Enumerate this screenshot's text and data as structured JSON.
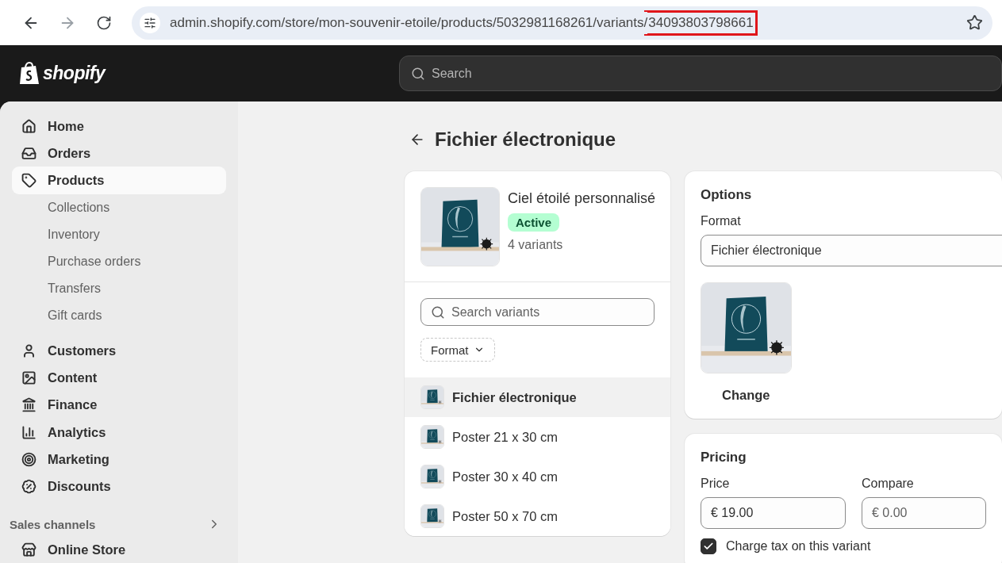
{
  "browser": {
    "url": "admin.shopify.com/store/mon-souvenir-etoile/products/5032981168261/variants/",
    "url_highlight": "34093803798661"
  },
  "topbar": {
    "logo": "shopify",
    "search_placeholder": "Search"
  },
  "sidebar": {
    "items": [
      {
        "label": "Home",
        "selected": false
      },
      {
        "label": "Orders",
        "selected": false
      },
      {
        "label": "Products",
        "selected": true,
        "children": [
          {
            "label": "Collections",
            "selected": false
          },
          {
            "label": "Inventory",
            "selected": false
          },
          {
            "label": "Purchase orders",
            "selected": false
          },
          {
            "label": "Transfers",
            "selected": false
          },
          {
            "label": "Gift cards",
            "selected": false
          }
        ]
      },
      {
        "label": "Customers",
        "selected": false
      },
      {
        "label": "Content",
        "selected": false
      },
      {
        "label": "Finance",
        "selected": false
      },
      {
        "label": "Analytics",
        "selected": false
      },
      {
        "label": "Marketing",
        "selected": false
      },
      {
        "label": "Discounts",
        "selected": false
      }
    ],
    "sections": [
      {
        "title": "Sales channels",
        "items": [
          {
            "label": "Online Store",
            "selected": false
          }
        ]
      }
    ]
  },
  "page": {
    "title": "Fichier électronique"
  },
  "product": {
    "name": "Ciel étoilé personnalisé",
    "status": "Active",
    "variant_count": "4 variants"
  },
  "variant_search": {
    "placeholder": "Search variants"
  },
  "filter": {
    "label": "Format"
  },
  "variants": [
    {
      "label": "Fichier électronique",
      "selected": true
    },
    {
      "label": "Poster 21 x 30 cm",
      "selected": false
    },
    {
      "label": "Poster 30 x 40 cm",
      "selected": false
    },
    {
      "label": "Poster 50 x 70 cm",
      "selected": false
    }
  ],
  "options": {
    "title": "Options",
    "option_label": "Format",
    "value": "Fichier électronique",
    "change": "Change"
  },
  "pricing": {
    "title": "Pricing",
    "price_label": "Price",
    "price_currency": "€",
    "price": "19.00",
    "compare_label": "Compare",
    "compare_currency": "€",
    "compare_placeholder": "0.00",
    "tax": {
      "label": "Charge tax on this variant",
      "checked": true
    }
  }
}
